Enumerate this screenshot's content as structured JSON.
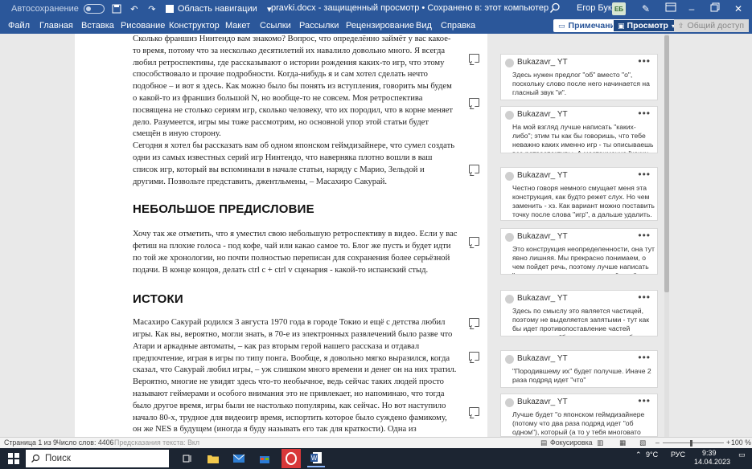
{
  "titlebar": {
    "autosave_label": "Автосохранение",
    "nav_area_label": "Область навигации",
    "document_title": "pravki.docx  -  защищенный просмотр • Сохранено в: этот компьютер",
    "user_name": "Егор Букин",
    "avatar_initials": "ЕБ"
  },
  "menu": {
    "items": [
      "Файл",
      "Главная",
      "Вставка",
      "Рисование",
      "Конструктор",
      "Макет",
      "Ссылки",
      "Рассылки",
      "Рецензирование",
      "Вид",
      "Справка"
    ],
    "notes_button": "Примечания",
    "view_button": "Просмотр",
    "share_button": "Общий доступ"
  },
  "document": {
    "p1": "Сколько франшиз Нинтендо вам знакомо? Вопрос, что определённо займёт у вас какое-то время, потому что за несколько десятилетий их навалило довольно много. Я всегда любил ретроспективы, где рассказывают о истории рождения каких-то игр, что этому способствовало и прочие подробности. Когда-нибудь я и сам хотел сделать нечто подобное – и вот я здесь. Как можно было бы понять из вступления, говорить мы будем о какой-то из франшиз большой N, но вообще-то не совсем. Моя ретроспектива посвящена не столько сериям игр, сколько человеку, что их породил, что в корне меняет дело. Разумеется, игры мы тоже рассмотрим, но основной упор этой статьи будет смещён в иную сторону.",
    "p2": "Сегодня я хотел бы рассказать вам об одном японском геймдизайнере, что сумел создать одни из самых известных серий игр Нинтендо, что наверняка плотно вошли в ваш список игр, который вы вспоминали в начале статьи, наряду с Марио, Зельдой и другими. Позвольте представить, джентльмены, – Масахиро Сакурай.",
    "heading1": "НЕБОЛЬШОЕ ПРЕДИСЛОВИЕ",
    "p3": "Хочу так же отметить, что я уместил свою небольшую ретроспективу в видео. Если у вас фетиш на плохие голоса - под кофе, чай или какао самое то. Блог же пусть и будет идти по той же хронологии, но почти полностью переписан для сохранения более серьёзной подачи. В конце концов, делать ctrl c + ctrl v сценария - какой-то испанский стыд.",
    "heading2": "ИСТОКИ",
    "p4": "Масахиро Сакурай родился 3 августа 1970 года в городе Токио и ещё с детства любил игры. Как вы, вероятно, могли знать, в 70-е из электронных развлечений было разве что Атари и аркадные автоматы, – как раз вторым герой нашего рассказа и отдавал предпочтение, играя в игры по типу понга. Вообще, я довольно мягко выразился, когда сказал, что Сакурай любил игры, – уж слишком много времени и денег он на них тратил. Вероятно, многие не увидят здесь что-то необычное, ведь сейчас таких людей просто называют геймерами и особого внимания это не привлекает, но напоминаю, что тогда было другое время, игры были не настолько популярны, как сейчас. Но вот наступило начало 80-х, трудное для видеоигр время, испортить которое было суждено фамикому, он же NES в будущем (иногда я буду называть его так для краткости). Одна из особенностей фамикома заключалась в том, что на нём вполне можно было программировать свои"
  },
  "comments": [
    {
      "author": "Bukazavr_ YT",
      "text": "Здесь нужен предлог \"об\" вместо \"о\", поскольку слово после него начинается на гласный звук \"и\"."
    },
    {
      "author": "Bukazavr_ YT",
      "text": "На мой взгляд лучше написать \"каких-либо\"; этим ты как бы говоришь, что тебе неважно каких именно игр - ты описываешь все ретроспективы. А местоимение \"каких-то\""
    },
    {
      "author": "Bukazavr_ YT",
      "text": "Честно говоря немного смущает меня эта конструкция, как будто режет слух. Но чем заменить - хз. Как вариант можно поставить точку после слова \"игр\", а дальше удалить."
    },
    {
      "author": "Bukazavr_ YT",
      "text": "Это конструкция неопределенности, она тут явно лишняя. Мы прекрасно понимаем, о чем пойдет речь, поэтому лучше написать \"из вступления вы могли понять\" или \"из"
    },
    {
      "author": "Bukazavr_ YT",
      "text": "Здесь по смыслу это является частицей, поэтому не выделяется запятыми - тут как бы идет противопоставление частей предложения. \"будем говорить - вообще-то не"
    },
    {
      "author": "Bukazavr_ YT",
      "text": "\"Породившему их\" будет получше. Иначе 2 раза подряд идет \"что\""
    },
    {
      "author": "Bukazavr_ YT",
      "text": "Лучше будет \"о японском геймдизайнере (потому что два раза подряд идет \"об одном\"), который (а то у тебя многовато \"что\") сумел"
    }
  ],
  "statusbar": {
    "page": "Страница 1 из 9",
    "words": "Число слов: 4406",
    "prediction": "Предсказания текста: Вкл",
    "focus": "Фокусировка",
    "zoom": "100 %"
  },
  "taskbar": {
    "search_label": "Поиск",
    "weather": "9°C",
    "language": "РУС",
    "time": "9:39",
    "date": "14.04.2023"
  },
  "colors": {
    "brand": "#2b579a",
    "taskbar": "#1c2532"
  }
}
